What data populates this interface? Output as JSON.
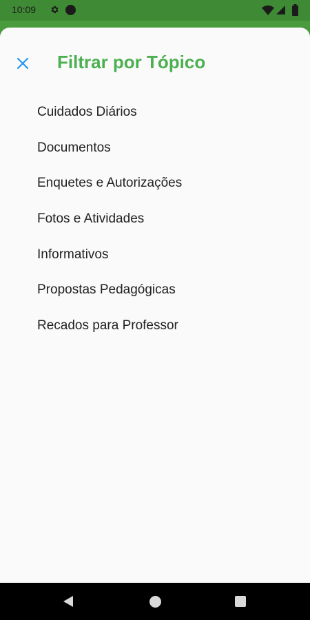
{
  "status_bar": {
    "time": "10:09",
    "icons": [
      "gear-icon",
      "notification-dot-icon",
      "wifi-icon",
      "signal-icon",
      "battery-icon"
    ]
  },
  "sheet": {
    "title": "Filtrar por Tópico",
    "close_icon": "close-icon",
    "topics": [
      "Cuidados Diários",
      "Documentos",
      "Enquetes e Autorizações",
      "Fotos e Atividades",
      "Informativos",
      "Propostas Pedagógicas",
      "Recados para Professor"
    ]
  },
  "nav_bar": {
    "icons": [
      "back-icon",
      "home-icon",
      "recents-icon"
    ]
  },
  "colors": {
    "accent_green": "#4caf50",
    "status_bar_green": "#3f8a35",
    "close_icon_blue": "#2196f3",
    "sheet_background": "#fafafa",
    "text_primary": "#212121"
  }
}
